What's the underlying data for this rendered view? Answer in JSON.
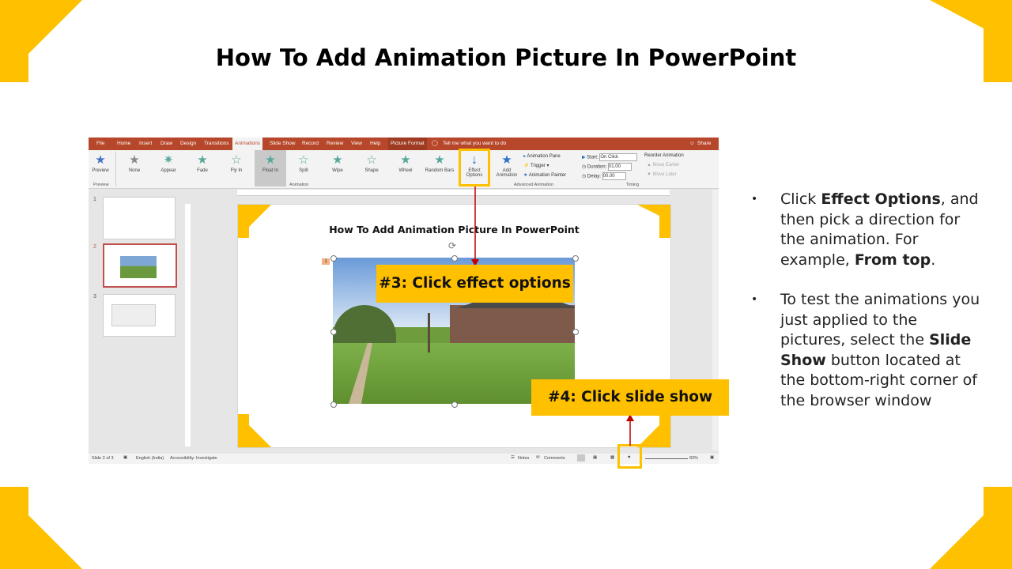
{
  "slide_title": "How To Add Animation Picture In PowerPoint",
  "ribbon_tabs": [
    "File",
    "Home",
    "Insert",
    "Draw",
    "Design",
    "Transitions",
    "Animations",
    "Slide Show",
    "Record",
    "Review",
    "View",
    "Help",
    "Picture Format"
  ],
  "tell_me": "Tell me what you want to do",
  "share": "Share",
  "preview": {
    "label": "Preview",
    "group": "Preview"
  },
  "effects": [
    {
      "label": "None"
    },
    {
      "label": "Appear"
    },
    {
      "label": "Fade"
    },
    {
      "label": "Fly In"
    },
    {
      "label": "Float In"
    },
    {
      "label": "Split"
    },
    {
      "label": "Wipe"
    },
    {
      "label": "Shape"
    },
    {
      "label": "Wheel"
    },
    {
      "label": "Random Bars"
    }
  ],
  "groups": {
    "animation": "Animation",
    "advanced": "Advanced Animation",
    "timing": "Timing"
  },
  "effect_options": {
    "line1": "Effect",
    "line2": "Options"
  },
  "add_animation": {
    "line1": "Add",
    "line2": "Animation"
  },
  "advanced": {
    "pane": "Animation Pane",
    "trigger": "Trigger",
    "painter": "Animation Painter"
  },
  "timing": {
    "start_label": "Start:",
    "start_value": "On Click",
    "duration_label": "Duration:",
    "duration_value": "01.00",
    "delay_label": "Delay:",
    "delay_value": "00.00"
  },
  "reorder": {
    "title": "Reorder Animation",
    "earlier": "Move Earlier",
    "later": "Move Later"
  },
  "thumbs": [
    {
      "num": "1"
    },
    {
      "num": "2"
    },
    {
      "num": "3"
    }
  ],
  "inner_slide_title": "How To Add Animation Picture In PowerPoint",
  "anim_tag": "1",
  "callout1": "#3: Click effect options",
  "callout2": "#4: Click slide show",
  "status": {
    "slide": "Slide 2 of 3",
    "language": "English (India)",
    "accessibility": "Accessibility: Investigate",
    "notes": "Notes",
    "comments": "Comments",
    "zoom": "83%"
  },
  "bullet1": {
    "p1": "Click ",
    "b1": "Effect Options",
    "p2": ", and then pick a direction for the animation. For example, ",
    "b2": "From top",
    "p3": "."
  },
  "bullet2": {
    "p1": "To test the animations you just applied to the pictures, select the ",
    "b1": "Slide Show",
    "p2": " button located at the bottom-right  corner of the browser window"
  },
  "colors": {
    "accent": "#ffc000",
    "ribbon": "#b7472a",
    "arrow": "#c00000"
  }
}
